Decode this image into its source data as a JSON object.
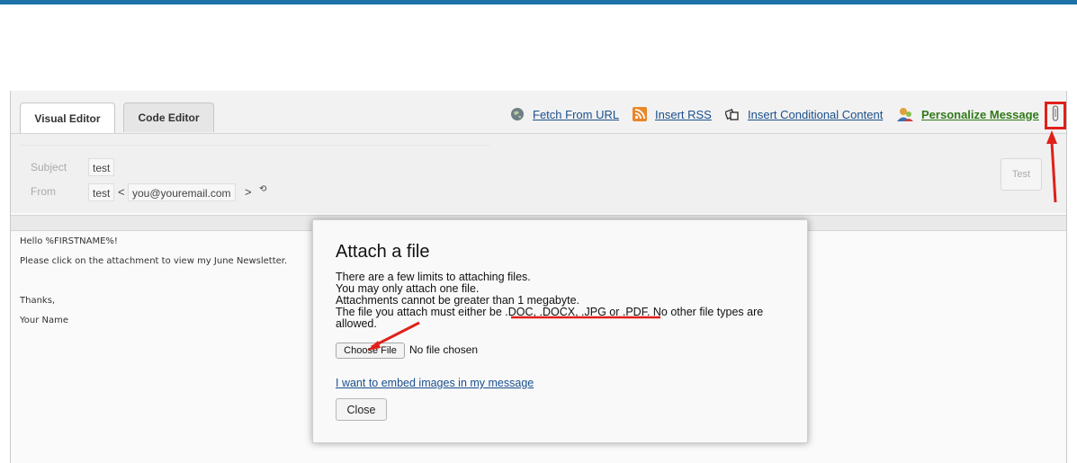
{
  "toolbar": {
    "tabs": [
      {
        "label": "Visual Editor",
        "active": true
      },
      {
        "label": "Code Editor",
        "active": false
      }
    ],
    "links": {
      "fetch_url": "Fetch From URL",
      "insert_rss": "Insert RSS",
      "conditional": "Insert Conditional Content",
      "personalize": "Personalize Message"
    },
    "icons": [
      "globe-icon",
      "rss-icon",
      "conditional-icon",
      "personalize-icon",
      "paperclip-icon"
    ]
  },
  "header": {
    "subject_label": "Subject",
    "subject_value": "test",
    "from_label": "From",
    "from_name": "test",
    "from_lt": "<",
    "from_email": "you@youremail.com",
    "from_gt": ">",
    "from_reset": "⟲",
    "test_button": "Test"
  },
  "body": {
    "lines": [
      "Hello %FIRSTNAME%!",
      "Please click on the attachment to view my June Newsletter.",
      "Thanks,",
      "Your Name"
    ]
  },
  "modal": {
    "title": "Attach a file",
    "intro": "There are a few limits to attaching files.",
    "one_file": "You may only attach one file.",
    "size_limit": "Attachments cannot be greater than 1 megabyte.",
    "type_line_1": "The file you attach must either be .DOC, .DOCX, .JPG or .PDF. No other file types are",
    "type_line_2": "allowed.",
    "choose_file": "Choose File",
    "no_file": "No file chosen",
    "embed_link": "I want to embed images in my message",
    "close": "Close"
  },
  "colors": {
    "accent_bar": "#1d72a8",
    "link": "#1a4f8c",
    "personalize_link": "#2f7a18",
    "annotation": "#e0201a"
  }
}
